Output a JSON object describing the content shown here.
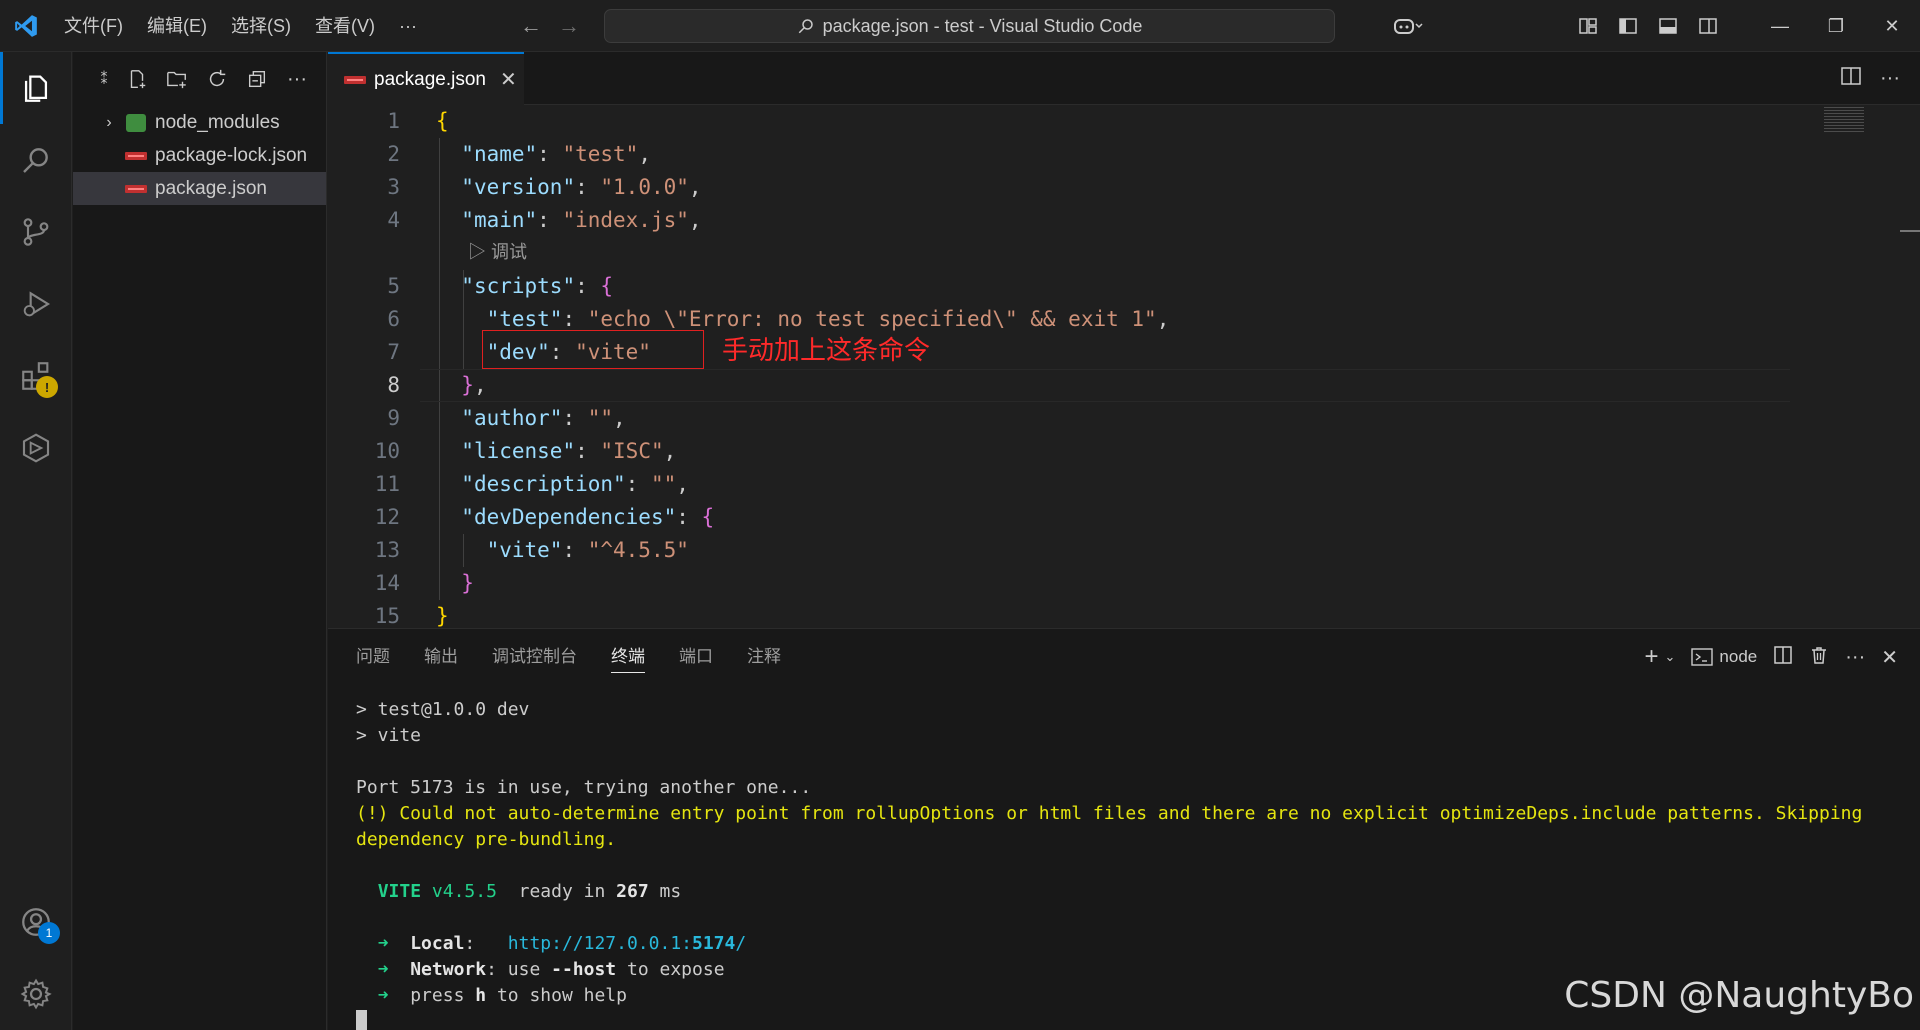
{
  "titlebar": {
    "menu": [
      "文件(F)",
      "编辑(E)",
      "选择(S)",
      "查看(V)",
      "···"
    ],
    "search_text": "package.json - test - Visual Studio Code"
  },
  "activitybar": {
    "items": [
      "explorer",
      "search",
      "source-control",
      "run-debug",
      "extensions",
      "remote-explorer"
    ],
    "accounts_badge": "1",
    "extensions_warning": "!"
  },
  "explorer": {
    "items": [
      {
        "label": "node_modules",
        "type": "folder"
      },
      {
        "label": "package-lock.json",
        "type": "json"
      },
      {
        "label": "package.json",
        "type": "json",
        "selected": true
      }
    ]
  },
  "editor": {
    "tab_label": "package.json",
    "codelens": "调试",
    "annotation": "手动加上这条命令",
    "line_numbers": [
      "1",
      "2",
      "3",
      "4",
      "5",
      "6",
      "7",
      "8",
      "9",
      "10",
      "11",
      "12",
      "13",
      "14",
      "15"
    ],
    "current_line": "8"
  },
  "panel": {
    "tabs": [
      "问题",
      "输出",
      "调试控制台",
      "终端",
      "端口",
      "注释"
    ],
    "active_tab": "终端",
    "shell_label": "node",
    "terminal": {
      "line1": "> test@1.0.0 dev",
      "line2": "> vite",
      "line3": "Port 5173 is in use, trying another one...",
      "line4": "(!) Could not auto-determine entry point from rollupOptions or html files and there are no explicit optimizeDeps.include patterns. Skipping",
      "line5": "dependency pre-bundling.",
      "vite_name": "VITE",
      "vite_version": "v4.5.5",
      "ready_text": "ready in",
      "ready_ms": "267",
      "ms": "ms",
      "local_label": "Local",
      "local_url_prefix": "http://127.0.0.1:",
      "local_port": "5174",
      "network_label": "Network",
      "network_text_1": "use",
      "network_flag": "--host",
      "network_text_2": "to expose",
      "help_text_1": "press",
      "help_key": "h",
      "help_text_2": "to show help"
    }
  },
  "watermark": "CSDN @NaughtyBo"
}
